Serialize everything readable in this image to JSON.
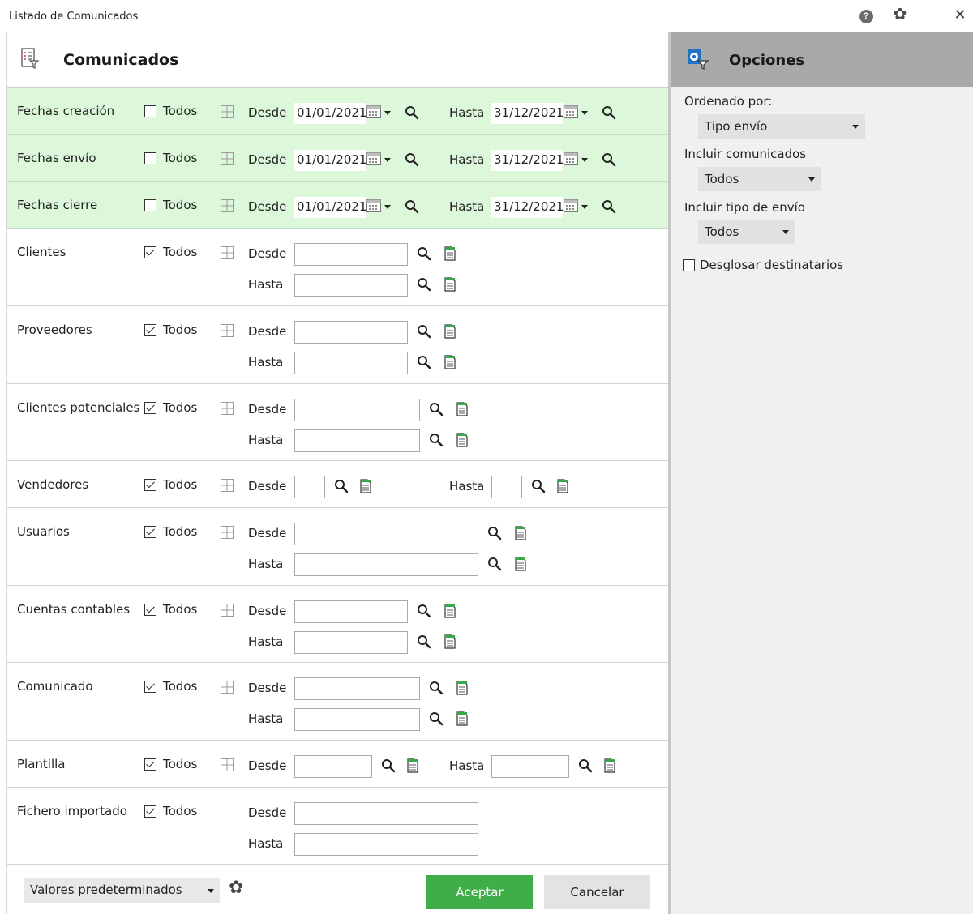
{
  "window": {
    "title": "Listado de Comunicados",
    "icons": [
      "help-icon",
      "settings-icon",
      "close-icon"
    ]
  },
  "main": {
    "title": "Comunicados",
    "todos_label": "Todos",
    "desde_label": "Desde",
    "hasta_label": "Hasta",
    "rows": [
      {
        "label": "Fechas creación",
        "todos_checked": false,
        "type": "date",
        "desde": "01/01/2021",
        "hasta": "31/12/2021"
      },
      {
        "label": "Fechas envío",
        "todos_checked": false,
        "type": "date",
        "desde": "01/01/2021",
        "hasta": "31/12/2021"
      },
      {
        "label": "Fechas cierre",
        "todos_checked": false,
        "type": "date",
        "desde": "01/01/2021",
        "hasta": "31/12/2021"
      },
      {
        "label": "Clientes",
        "todos_checked": true,
        "type": "range",
        "desde": "",
        "hasta": ""
      },
      {
        "label": "Proveedores",
        "todos_checked": true,
        "type": "range",
        "desde": "",
        "hasta": ""
      },
      {
        "label": "Clientes potenciales",
        "todos_checked": true,
        "type": "range",
        "desde": "",
        "hasta": ""
      },
      {
        "label": "Vendedores",
        "todos_checked": true,
        "type": "inline",
        "desde": "",
        "hasta": ""
      },
      {
        "label": "Usuarios",
        "todos_checked": true,
        "type": "range",
        "desde": "",
        "hasta": ""
      },
      {
        "label": "Cuentas contables",
        "todos_checked": true,
        "type": "range",
        "desde": "",
        "hasta": ""
      },
      {
        "label": "Comunicado",
        "todos_checked": true,
        "type": "range",
        "desde": "",
        "hasta": ""
      },
      {
        "label": "Plantilla",
        "todos_checked": true,
        "type": "inline",
        "desde": "",
        "hasta": ""
      },
      {
        "label": "Fichero importado",
        "todos_checked": true,
        "type": "range-plain",
        "desde": "",
        "hasta": ""
      }
    ]
  },
  "footer": {
    "preset_value": "Valores predeterminados",
    "accept_label": "Aceptar",
    "cancel_label": "Cancelar"
  },
  "options": {
    "title": "Opciones",
    "order_label": "Ordenado por:",
    "order_value": "Tipo envío",
    "include_label": "Incluir comunicados",
    "include_value": "Todos",
    "include_type_label": "Incluir tipo de envío",
    "include_type_value": "Todos",
    "breakdown_label": "Desglosar destinatarios",
    "breakdown_checked": false
  },
  "colors": {
    "accent": "#3fae49",
    "date_row_bg": "#dcf7d9",
    "options_header_bg": "#a9a9a9"
  }
}
